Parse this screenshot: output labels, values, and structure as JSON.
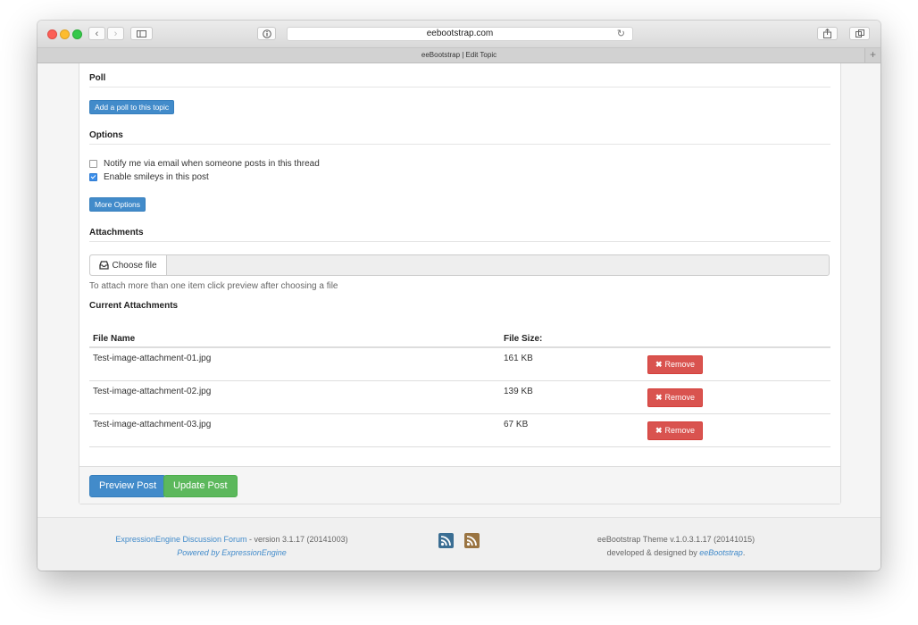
{
  "browser": {
    "url": "eebootstrap.com",
    "tab_title": "eeBootstrap | Edit Topic",
    "plus": "+"
  },
  "poll": {
    "title": "Poll",
    "add_button": "Add a poll to this topic"
  },
  "options": {
    "title": "Options",
    "notify_label": "Notify me via email when someone posts in this thread",
    "notify_checked": false,
    "smileys_label": "Enable smileys in this post",
    "smileys_checked": true,
    "more_button": "More Options"
  },
  "attachments": {
    "title": "Attachments",
    "choose_file": "Choose file",
    "help": "To attach more than one item click preview after choosing a file",
    "current_title": "Current Attachments",
    "columns": [
      "File Name",
      "File Size:"
    ],
    "rows": [
      {
        "name": "Test-image-attachment-01.jpg",
        "size": "161 KB",
        "action": "Remove"
      },
      {
        "name": "Test-image-attachment-02.jpg",
        "size": "139 KB",
        "action": "Remove"
      },
      {
        "name": "Test-image-attachment-03.jpg",
        "size": "67 KB",
        "action": "Remove"
      }
    ]
  },
  "actions": {
    "preview": "Preview Post",
    "update": "Update Post"
  },
  "footer": {
    "forum_link": "ExpressionEngine Discussion Forum",
    "version": " - version 3.1.17 (20141003)",
    "powered": "Powered by ExpressionEngine",
    "theme": "eeBootstrap Theme v.1.0.3.1.17 (20141015)",
    "developed": "developed & designed by ",
    "dev_link": "eeBootstrap",
    "dev_end": ".",
    "rss_colors": [
      "#3b6e93",
      "#9a7442"
    ]
  }
}
